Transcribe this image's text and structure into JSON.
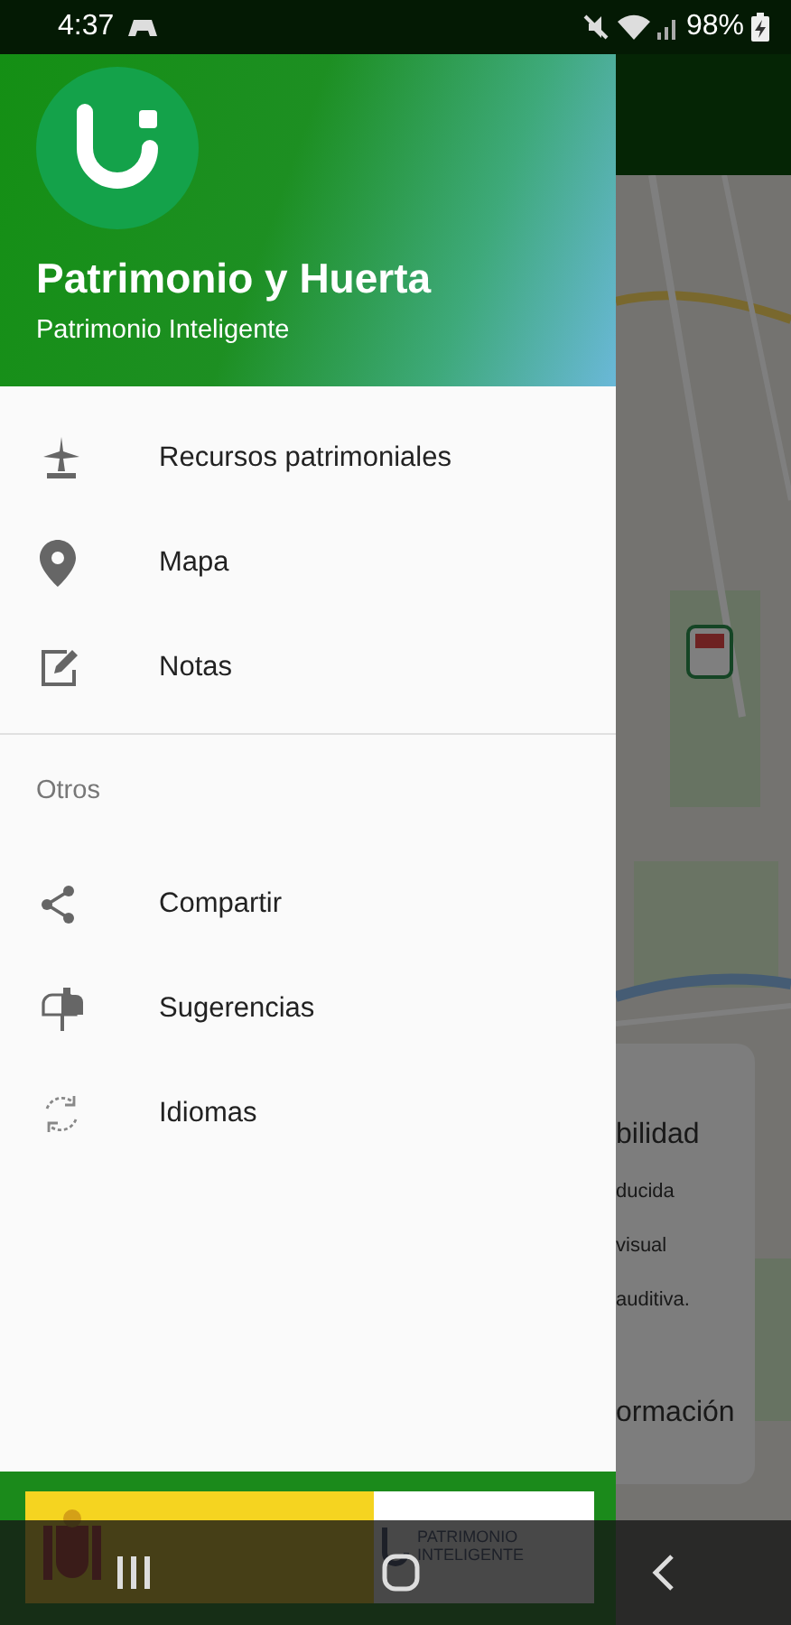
{
  "status_bar": {
    "time": "4:37",
    "battery": "98%"
  },
  "drawer": {
    "title": "Patrimonio y Huerta",
    "subtitle": "Patrimonio Inteligente",
    "sections": [
      {
        "items": [
          {
            "label": "Recursos patrimoniales"
          },
          {
            "label": "Mapa"
          },
          {
            "label": "Notas"
          }
        ]
      },
      {
        "heading": "Otros",
        "items": [
          {
            "label": "Compartir"
          },
          {
            "label": "Sugerencias"
          },
          {
            "label": "Idiomas"
          }
        ]
      }
    ],
    "footer": {
      "brand": "PATRIMONIO INTELIGENTE"
    }
  },
  "background_card": {
    "title": "bilidad",
    "lines": [
      "ducida",
      "visual",
      "auditiva."
    ],
    "action": "ormación"
  }
}
